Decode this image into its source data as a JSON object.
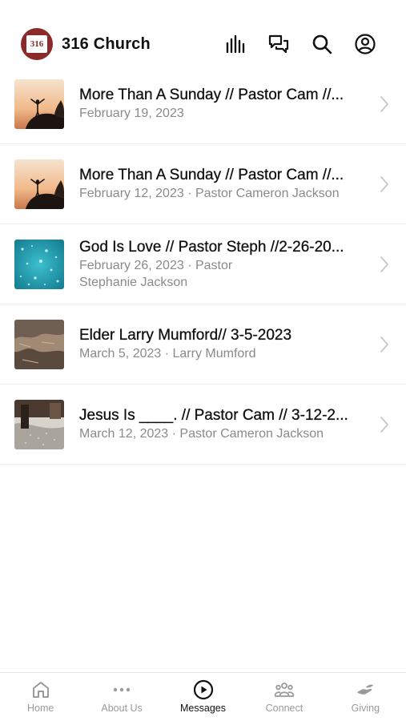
{
  "header": {
    "logo_text": "316",
    "title": "316 Church",
    "actions": [
      {
        "icon": "audio-bars-icon"
      },
      {
        "icon": "chat-bubbles-icon"
      },
      {
        "icon": "search-icon"
      },
      {
        "icon": "account-icon"
      }
    ]
  },
  "messages": [
    {
      "title": "More Than A Sunday // Pastor Cam //...",
      "subtitle": "February 19, 2023",
      "thumb": "sunset-person-icon"
    },
    {
      "title": "More Than A Sunday // Pastor Cam //...",
      "subtitle": "February 12, 2023 · Pastor Cameron Jackson",
      "thumb": "sunset-person-icon"
    },
    {
      "title": "God Is Love // Pastor Steph //2-26-20...",
      "subtitle": "February 26, 2023 · Pastor",
      "subtitle2": "Stephanie Jackson",
      "thumb": "teal-sparkle-icon"
    },
    {
      "title": "Elder Larry Mumford// 3-5-2023",
      "subtitle": "March 5, 2023 · Larry Mumford",
      "thumb": "canyon-icon"
    },
    {
      "title": "Jesus Is ____. // Pastor Cam // 3-12-2...",
      "subtitle": "March 12, 2023 · Pastor Cameron Jackson",
      "thumb": "interior-icon"
    }
  ],
  "tabs": [
    {
      "label": "Home",
      "icon": "home-icon",
      "active": false
    },
    {
      "label": "About Us",
      "icon": "ellipsis-icon",
      "active": false
    },
    {
      "label": "Messages",
      "icon": "play-circle-icon",
      "active": true
    },
    {
      "label": "Connect",
      "icon": "group-icon",
      "active": false
    },
    {
      "label": "Giving",
      "icon": "giving-hand-icon",
      "active": false
    }
  ],
  "colors": {
    "brand": "#8b2a2a",
    "text": "#111111",
    "muted": "#8a8a8a",
    "tab_inactive": "#9a9a9a"
  }
}
